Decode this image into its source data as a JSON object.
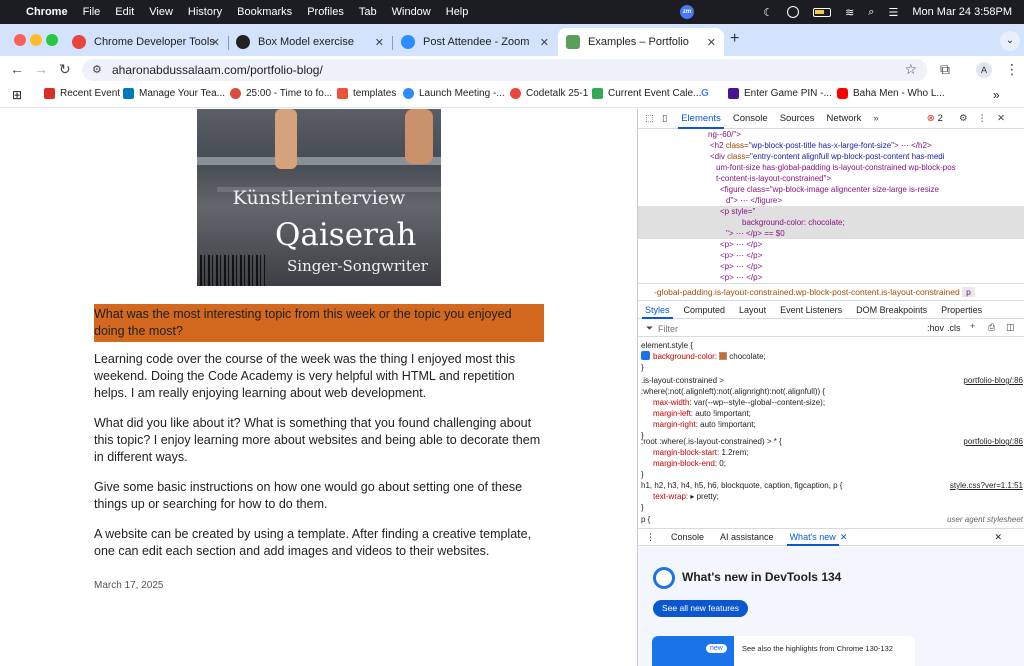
{
  "menubar": {
    "app": "Chrome",
    "items": [
      "File",
      "Edit",
      "View",
      "History",
      "Bookmarks",
      "Profiles",
      "Tab",
      "Window",
      "Help"
    ],
    "zoom_badge": "zm",
    "datetime": "Mon Mar 24  3:58PM"
  },
  "tabs": [
    {
      "title": "Chrome Developer Tools",
      "fav_color": "#e8453c"
    },
    {
      "title": "Box Model exercise",
      "fav_color": "#222222"
    },
    {
      "title": "Post Attendee - Zoom",
      "fav_color": "#2d8cff"
    },
    {
      "title": "Examples – Portfolio",
      "fav_color": "#5a9e5a",
      "active": true
    }
  ],
  "omnibox": {
    "url": "aharonabdussalaam.com/portfolio-blog/"
  },
  "profile_initial": "A",
  "bookmarks": [
    {
      "label": "Recent Event",
      "color": "#d93025",
      "badge": "TED"
    },
    {
      "label": "Manage Your Tea...",
      "color": "#0079bf"
    },
    {
      "label": "25:00 - Time to fo...",
      "color": "#db4c3f"
    },
    {
      "label": "templates",
      "color": "#e8533a"
    },
    {
      "label": "Launch Meeting -...",
      "color": "#2d8cff"
    },
    {
      "label": "Codetalk 25-1",
      "color": "#e8453c"
    },
    {
      "label": "Current Event Cale...",
      "color": "#34a853"
    },
    {
      "label": "G",
      "color": "#ffffff"
    },
    {
      "label": "Enter Game PIN -...",
      "color": "#46178f"
    },
    {
      "label": "Baha Men - Who L...",
      "color": "#ff0000"
    }
  ],
  "hero": {
    "line1": "Künstlerinterview",
    "line2": "Qaiserah",
    "line3": "Singer-Songwriter"
  },
  "article": {
    "question": "What was the most interesting topic from this week or the topic you enjoyed doing the most?",
    "p1": "Learning code over the course of the week was the thing I enjoyed most this weekend. Doing the Code Academy is very helpful with HTML and repetition helps. I am really enjoying learning about web development.",
    "p2": "What did you like about it? What is something that you found challenging about this topic? I enjoy learning more about websites and being able to decorate them in different ways.",
    "p3": "Give some basic instructions on how one would go about setting one of these things up or searching for how to do them.",
    "p4": "A website can be created by using a template. After finding a creative template, one can edit each section and add images and videos to their websites.",
    "date": "March 17, 2025",
    "highlight_color": "#d2691e"
  },
  "devtools": {
    "tabs": [
      "Elements",
      "Console",
      "Sources",
      "Network"
    ],
    "error_count": "2",
    "dom": {
      "l0": "ng--60/\">",
      "l1_tag": "<h2 ",
      "l1_attr": "class=",
      "l1_val": "\"wp-block-post-title has-x-large-font-size\"",
      "l1_end": "> ⋯ </h2>",
      "l2a": "<div ",
      "l2b": "class=",
      "l2c": "\"entry-content alignfull wp-block-post-content has-medi",
      "l3": "um-font-size has-global-padding is-layout-constrained wp-block-pos",
      "l4": "t-content-is-layout-constrained\">",
      "l5": "<figure class=\"wp-block-image aligncenter size-large is-resize",
      "l6": "d\"> ⋯ </figure>",
      "l7": "<p style=\"",
      "l8": "background-color: chocolate;",
      "l9": "\"> ⋯ </p> == $0",
      "p1": "<p> ⋯ </p>",
      "p2": "<p> ⋯ </p>",
      "p3": "<p> ⋯ </p>",
      "p4": "<p> ⋯ </p>",
      "enddiv": "</div>"
    },
    "breadcrumb": "-global-padding.is-layout-constrained.wp-block-post-content.is-layout-constrained",
    "breadcrumb_tail": "p",
    "subtabs": [
      "Styles",
      "Computed",
      "Layout",
      "Event Listeners",
      "DOM Breakpoints",
      "Properties"
    ],
    "filter_placeholder": "Filter",
    "filter_tools": [
      ":hov",
      ".cls"
    ],
    "css": {
      "r1_sel": "element.style {",
      "r1_prop": "background-color",
      "r1_val": "chocolate;",
      "r2_sel": ".is-layout-constrained >",
      "r2_sel2": ":where(:not(.alignleft):not(.alignright):not(.alignfull)) {",
      "r2_link": "portfolio-blog/:86",
      "r2_p1": "max-width",
      "r2_v1": "var(--wp--style--global--content-size);",
      "r2_p2": "margin-left",
      "r2_v2": "auto !important;",
      "r2_p3": "margin-right",
      "r2_v3": "auto !important;",
      "r3_sel": ":root :where(.is-layout-constrained) > * {",
      "r3_link": "portfolio-blog/:86",
      "r3_p1": "margin-block-start",
      "r3_v1": "1.2rem;",
      "r3_p2": "margin-block-end",
      "r3_v2": "0;",
      "r4_sel": "h1, h2, h3, h4, h5, h6, blockquote, caption, figcaption, p {",
      "r4_link": "style.css?ver=1.1:51",
      "r4_p1": "text-wrap",
      "r4_v1": "pretty;",
      "r5_sel": "p {",
      "r5_ua": "user agent stylesheet",
      "close_brace": "}"
    },
    "drawer_tabs": [
      "Console",
      "AI assistance",
      "What's new"
    ],
    "whats_new_title": "What's new in DevTools 134",
    "see_all": "See all new features",
    "card_badge": "new",
    "card_text": "See also the highlights from Chrome 130-132"
  }
}
